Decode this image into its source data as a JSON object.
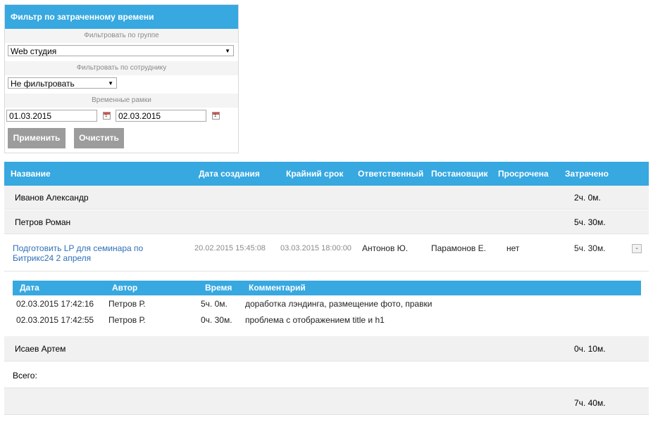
{
  "filter": {
    "title": "Фильтр по затраченному времени",
    "group_label": "Фильтровать по группе",
    "group_value": "Web студия",
    "employee_label": "Фильтровать по сотруднику",
    "employee_value": "Не фильтровать",
    "timeframe_label": "Временные рамки",
    "date_from": "01.03.2015",
    "date_to": "02.03.2015",
    "calendar_glyph": "1",
    "apply_label": "Применить",
    "clear_label": "Очистить"
  },
  "table": {
    "columns": [
      "Название",
      "Дата создания",
      "Крайний срок",
      "Ответственный",
      "Постановщик",
      "Просрочена",
      "Затрачено"
    ],
    "groups": [
      {
        "name": "Иванов Александр",
        "time": "2ч. 0м."
      },
      {
        "name": "Петров Роман",
        "time": "5ч. 30м."
      },
      {
        "name": "Исаев Артем",
        "time": "0ч. 10м."
      }
    ],
    "task": {
      "title": "Подготовить LP для семинара по Битрикс24 2 апреля",
      "created": "20.02.2015 15:45:08",
      "deadline": "03.03.2015 18:00:00",
      "responsible": "Антонов Ю.",
      "creator": "Парамонов Е.",
      "overdue": "нет",
      "spent": "5ч. 30м.",
      "collapse_label": "-"
    },
    "sub_columns": [
      "Дата",
      "Автор",
      "Время",
      "Комментарий"
    ],
    "sub_rows": [
      {
        "date": "02.03.2015 17:42:16",
        "author": "Петров Р.",
        "time": "5ч. 0м.",
        "comment": "доработка лэндинга, размещение фото, правки"
      },
      {
        "date": "02.03.2015 17:42:55",
        "author": "Петров Р.",
        "time": "0ч. 30м.",
        "comment": "проблема с отображением title и h1"
      }
    ],
    "total_label": "Всего:",
    "total_value": "7ч. 40м."
  },
  "colors": {
    "accent": "#37a8e0",
    "button": "#9c9c9c",
    "link": "#2e6fb7"
  }
}
